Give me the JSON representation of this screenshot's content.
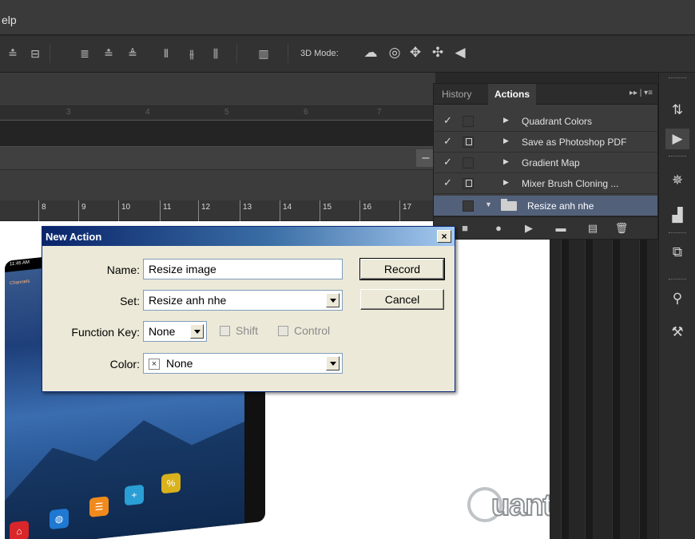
{
  "menubar": {
    "help_label": "elp"
  },
  "options_bar": {
    "mode3d_label": "3D Mode:",
    "align_icons": [
      "align-top-edges-icon",
      "align-vertical-centers-icon",
      "distribute-top-icon",
      "distribute-vcenter-icon",
      "distribute-bottom-icon",
      "distribute-left-icon",
      "distribute-hcenter-icon",
      "distribute-right-icon",
      "auto-align-icon"
    ],
    "mode3d_icons": [
      "rotate-3d-icon",
      "roll-3d-icon",
      "drag-3d-icon",
      "slide-3d-icon",
      "scale-3d-icon"
    ]
  },
  "rulers": {
    "top_ticks": [
      "3",
      "4",
      "5",
      "6",
      "7"
    ],
    "ruler2_ticks": [
      "8",
      "9",
      "10",
      "11",
      "12",
      "13",
      "14",
      "15",
      "16",
      "17"
    ]
  },
  "canvas": {
    "status_time": "11:45 AM",
    "channels_label": "Channels",
    "watermark_text": "uantrimang"
  },
  "panel": {
    "tabs": [
      {
        "label": "History",
        "active": false
      },
      {
        "label": "Actions",
        "active": true
      }
    ],
    "menu_glyph": "▸▸ | ▾≡",
    "actions": [
      {
        "label": "Quadrant Colors",
        "checked": true,
        "dialog": false,
        "selected": false
      },
      {
        "label": "Save as Photoshop PDF",
        "checked": true,
        "dialog": true,
        "selected": false
      },
      {
        "label": "Gradient Map",
        "checked": true,
        "dialog": false,
        "selected": false
      },
      {
        "label": "Mixer Brush Cloning ...",
        "checked": true,
        "dialog": true,
        "selected": false
      },
      {
        "label": "Resize anh nhe",
        "checked": false,
        "dialog": false,
        "selected": true
      }
    ],
    "bottom_icons": [
      "stop-icon",
      "record-icon",
      "play-icon",
      "new-set-folder-icon",
      "new-action-icon",
      "trash-icon"
    ]
  },
  "right_column": {
    "icons": [
      "history-panel-icon",
      "actions-play-icon",
      "navigator-wheel-icon",
      "histogram-icon",
      "layer-comps-icon",
      "brush-presets-icon",
      "tool-presets-icon"
    ]
  },
  "dialog": {
    "title": "New Action",
    "close_glyph": "×",
    "name_label": "Name:",
    "name_value": "Resize image",
    "set_label": "Set:",
    "set_value": "Resize anh nhe",
    "function_key_label": "Function Key:",
    "function_key_value": "None",
    "shift_label": "Shift",
    "control_label": "Control",
    "color_label": "Color:",
    "color_value": "None",
    "color_swatch_glyph": "×",
    "record_button": "Record",
    "cancel_button": "Cancel"
  }
}
